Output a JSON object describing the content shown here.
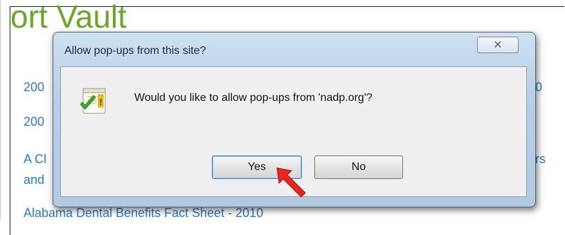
{
  "page": {
    "site_title": "ort Vault",
    "links": [
      {
        "text": "200"
      },
      {
        "text": "200"
      },
      {
        "text": "A Cl"
      },
      {
        "text": "and"
      },
      {
        "text": "Alabama Dental Benefits Fact Sheet - 2010"
      }
    ],
    "right_fragments": [
      {
        "text": "0"
      },
      {
        "text": "rs"
      }
    ]
  },
  "dialog": {
    "title": "Allow pop-ups from this site?",
    "close_glyph": "✕",
    "message": "Would you like to allow pop-ups from 'nadp.org'?",
    "icon": "checklist-warning-icon",
    "yes_label": "Yes",
    "no_label": "No"
  },
  "annotation": {
    "arrow_color": "#e8261f"
  }
}
